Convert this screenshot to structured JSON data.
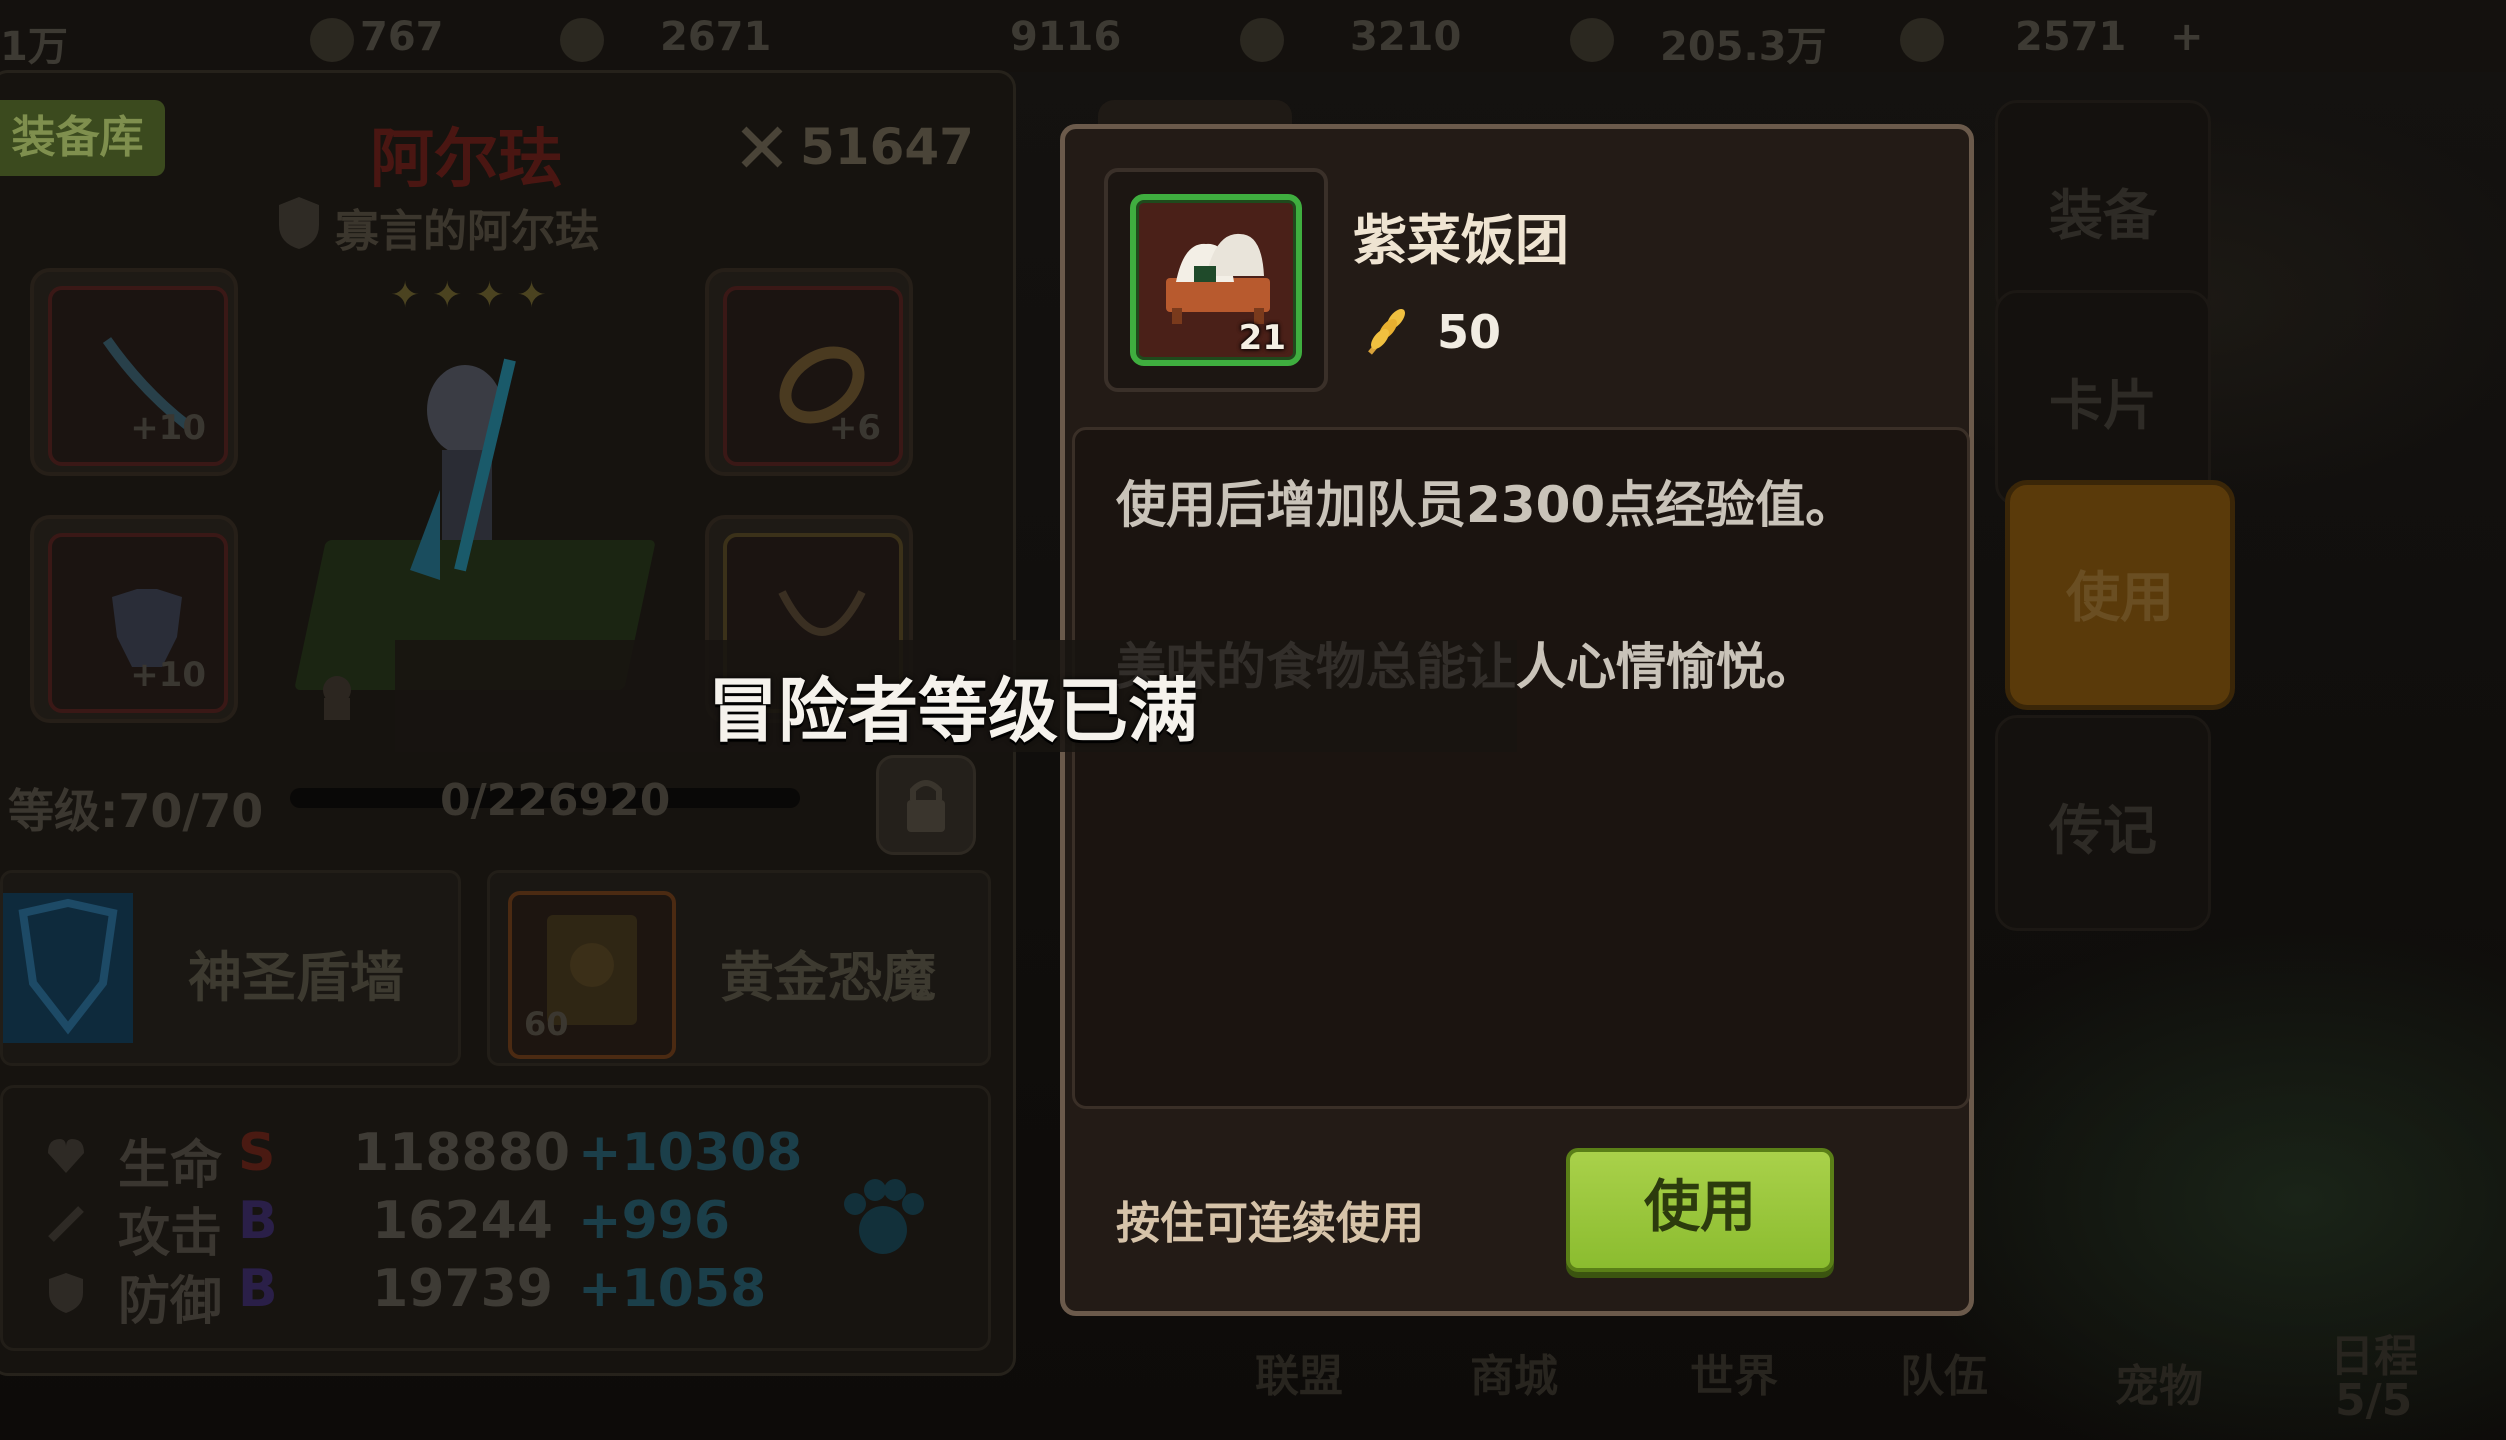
{
  "top_resources": [
    "1万",
    "767",
    "2671",
    "9116",
    "3210",
    "205.3万",
    "2571"
  ],
  "hero": {
    "store_tag": "装备库",
    "name": "阿尔珐",
    "power": "51647",
    "title": "寡言的阿尔珐",
    "stars": "✦✦✦✦",
    "equip_plus": [
      "+10",
      "+6",
      "+10"
    ],
    "level_label": "等级:70/70",
    "exp_text": "0/226920",
    "skill_1": "神圣盾墙",
    "skill_2": "黄金恐魔",
    "card_level": "60",
    "stats": [
      {
        "name": "生命",
        "grade": "S",
        "value": "118880",
        "bonus": "+10308"
      },
      {
        "name": "攻击",
        "grade": "B",
        "value": "16244",
        "bonus": "+996"
      },
      {
        "name": "防御",
        "grade": "B",
        "value": "19739",
        "bonus": "+1058"
      }
    ]
  },
  "side_tabs": [
    "装备",
    "卡片",
    "使用",
    "传记"
  ],
  "bottom_nav": [
    "联盟",
    "商城",
    "世界",
    "队伍",
    "宠物",
    "日程"
  ],
  "bottom_schedule_count": "5/5",
  "item": {
    "name": "紫菜饭团",
    "count": "21",
    "price": "50",
    "desc_1": "使用后增加队员2300点经验值。",
    "desc_2": "美味的食物总能让人心情愉悦。",
    "hold_hint": "按住可连续使用",
    "use_label": "使用"
  },
  "toast": "冒险者等级已满",
  "colors": {
    "use_button": "#9bc83b",
    "item_border": "#3fae3f",
    "modal_border": "#6b5a4b",
    "active_tab": "#5a3a0a"
  }
}
